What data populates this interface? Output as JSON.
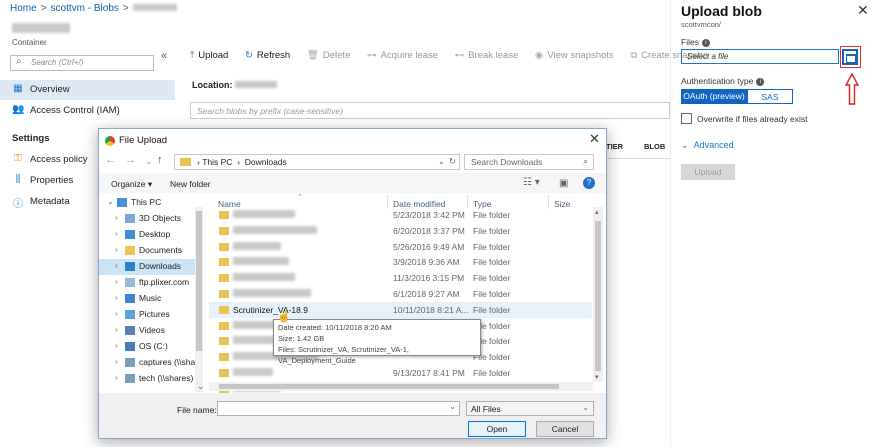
{
  "breadcrumb": {
    "home": "Home",
    "account": "scottvm - Blobs",
    "sep": ">"
  },
  "container_label": "Container",
  "left_nav": {
    "search_placeholder": "Search (Ctrl+/)",
    "collapse": "«",
    "overview": "Overview",
    "access_control": "Access Control (IAM)",
    "settings_title": "Settings",
    "access_policy": "Access policy",
    "properties": "Properties",
    "metadata": "Metadata"
  },
  "toolbar": {
    "upload": "Upload",
    "refresh": "Refresh",
    "delete": "Delete",
    "acquire_lease": "Acquire lease",
    "break_lease": "Break lease",
    "view_snapshots": "View snapshots",
    "create_snapshot": "Create snapsho"
  },
  "location_label": "Location:",
  "blob_search_placeholder": "Search blobs by prefix (case-sensitive)",
  "columns_partial": {
    "tier": "TIER",
    "blob": "BLOB"
  },
  "panel": {
    "title": "Upload blob",
    "subtitle": "scottvmcon/",
    "close": "✕",
    "files_label": "Files",
    "file_placeholder": "Select a file",
    "auth_label": "Authentication type",
    "auth_oauth": "OAuth (preview)",
    "auth_sas": "SAS",
    "overwrite": "Overwrite if files already exist",
    "advanced": "Advanced",
    "upload": "Upload"
  },
  "dialog": {
    "title": "File Upload",
    "close": "✕",
    "address": {
      "root": "This PC",
      "folder": "Downloads"
    },
    "search_placeholder": "Search Downloads",
    "organize": "Organize ▾",
    "new_folder": "New folder",
    "help": "?",
    "tree": [
      {
        "label": "This PC",
        "level": 0,
        "caret": "⌄"
      },
      {
        "label": "3D Objects",
        "level": 1,
        "caret": "›"
      },
      {
        "label": "Desktop",
        "level": 1,
        "caret": "›"
      },
      {
        "label": "Documents",
        "level": 1,
        "caret": "›"
      },
      {
        "label": "Downloads",
        "level": 1,
        "caret": "›",
        "selected": true
      },
      {
        "label": "ftp.plixer.com",
        "level": 1,
        "caret": "›"
      },
      {
        "label": "Music",
        "level": 1,
        "caret": "›"
      },
      {
        "label": "Pictures",
        "level": 1,
        "caret": "›"
      },
      {
        "label": "Videos",
        "level": 1,
        "caret": "›"
      },
      {
        "label": "OS (C:)",
        "level": 1,
        "caret": "›"
      },
      {
        "label": "captures (\\\\sha",
        "level": 1,
        "caret": "›"
      },
      {
        "label": "tech (\\\\shares)",
        "level": 1,
        "caret": "›"
      }
    ],
    "headers": {
      "name": "Name",
      "date": "Date modified",
      "type": "Type",
      "size": "Size"
    },
    "rows": [
      {
        "name": "",
        "date": "5/23/2018 3:42 PM",
        "type": "File folder"
      },
      {
        "name": "",
        "date": "6/20/2018 3:37 PM",
        "type": "File folder"
      },
      {
        "name": "",
        "date": "5/26/2016 9:49 AM",
        "type": "File folder"
      },
      {
        "name": "",
        "date": "3/9/2018 9:36 AM",
        "type": "File folder"
      },
      {
        "name": "",
        "date": "11/3/2016 3:15 PM",
        "type": "File folder"
      },
      {
        "name": "",
        "date": "6/1/2018 9:27 AM",
        "type": "File folder"
      },
      {
        "name": "Scrutinizer_VA-18.9",
        "date": "10/11/2018 8:21 A...",
        "type": "File folder",
        "highlight": true
      },
      {
        "name": "",
        "date": "",
        "type": "File folder"
      },
      {
        "name": "",
        "date": "",
        "type": "File folder"
      },
      {
        "name": "",
        "date": "",
        "type": "File folder"
      },
      {
        "name": "",
        "date": "9/13/2017 8:41 PM",
        "type": "File folder"
      },
      {
        "name": "",
        "date": "",
        "type": ""
      }
    ],
    "tooltip": {
      "created": "Date created: 10/11/2018 8:20 AM",
      "size": "Size: 1.42 GB",
      "files": "Files: Scrutinizer_VA, Scrutinizer_VA-1, VA_Deployment_Guide"
    },
    "file_name_label": "File name:",
    "filter": "All Files",
    "open": "Open",
    "cancel": "Cancel"
  }
}
